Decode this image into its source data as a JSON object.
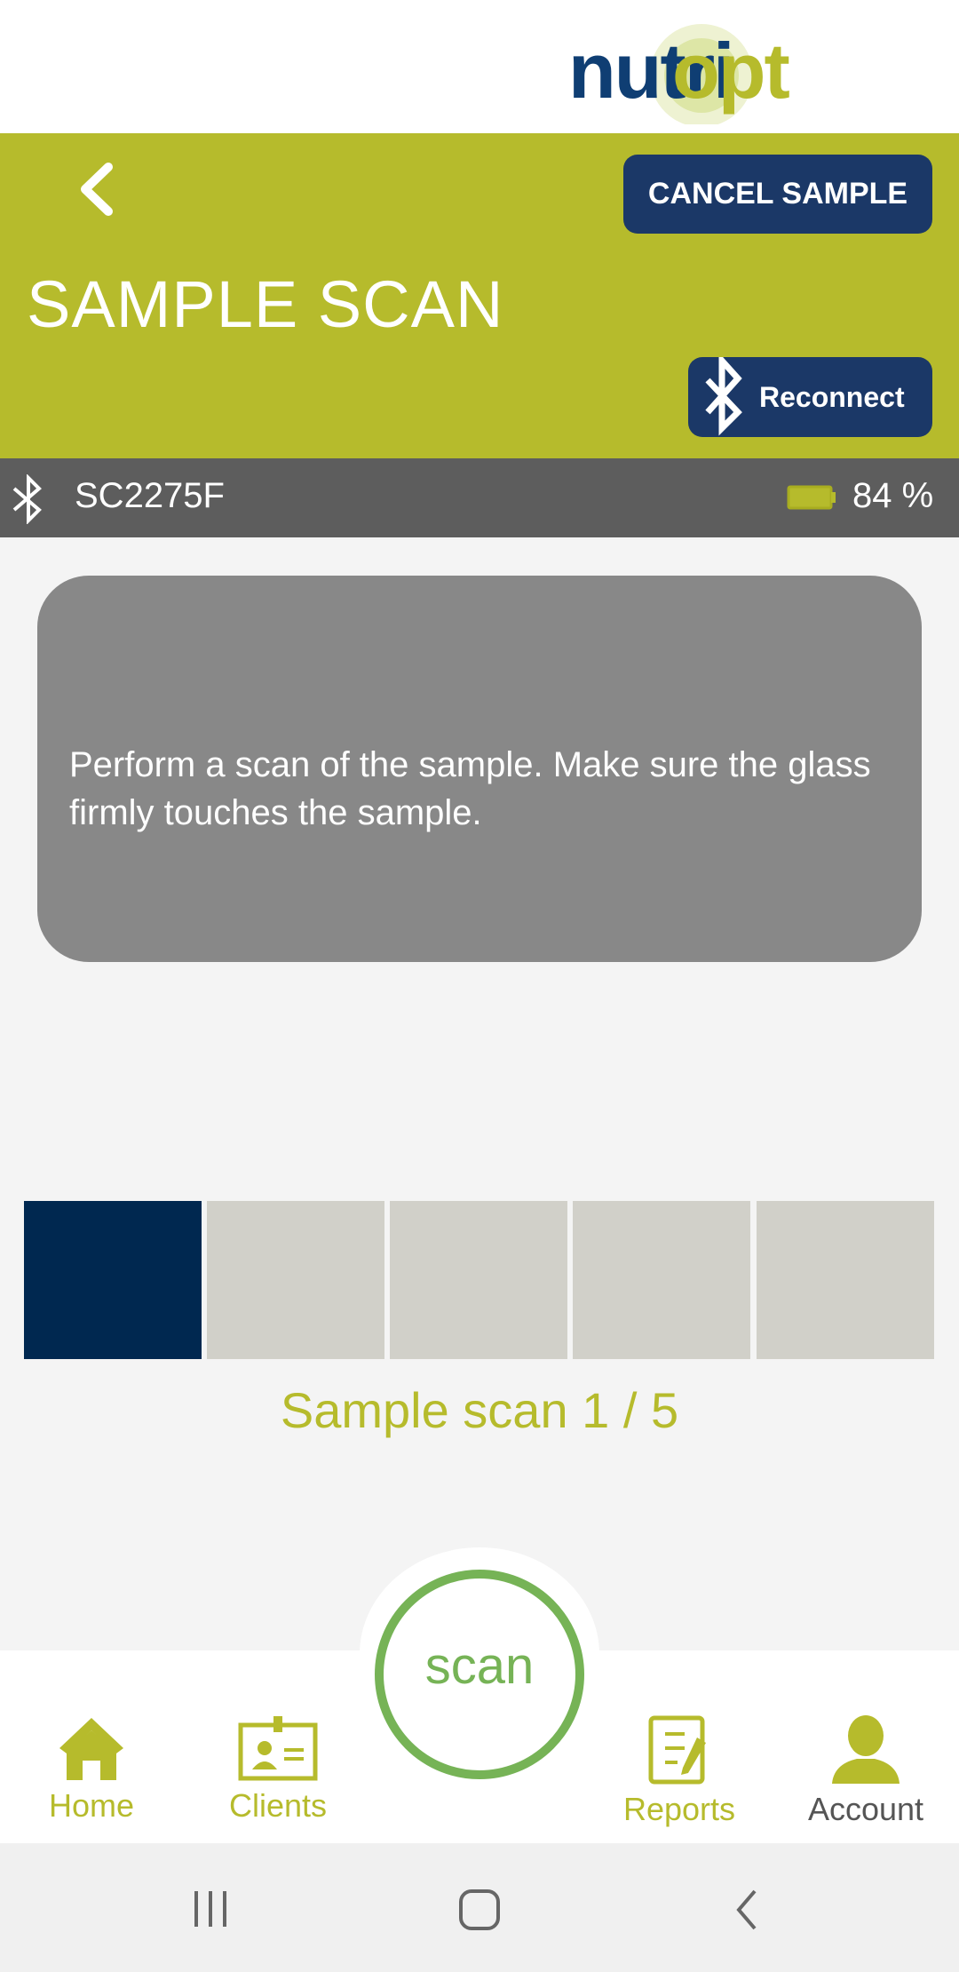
{
  "logo": {
    "text_part1": "nutri",
    "text_part2": "opt"
  },
  "header": {
    "title": "SAMPLE SCAN",
    "cancel_label": "CANCEL SAMPLE",
    "reconnect_label": "Reconnect"
  },
  "device": {
    "name": "SC2275F",
    "battery": "84 %",
    "battery_level": 84
  },
  "instruction": "Perform a scan of the sample. Make sure the glass firmly touches the sample.",
  "progress": {
    "label": "Sample scan 1 / 5",
    "completed": 1,
    "total": 5,
    "active_color": "#002850",
    "inactive_color": "#d1d0c9"
  },
  "scan_button": "scan",
  "nav": {
    "home": "Home",
    "clients": "Clients",
    "reports": "Reports",
    "account": "Account"
  },
  "colors": {
    "brand_green": "#b6bb2c",
    "brand_navy": "#1b3867",
    "scan_green": "#76b356"
  }
}
